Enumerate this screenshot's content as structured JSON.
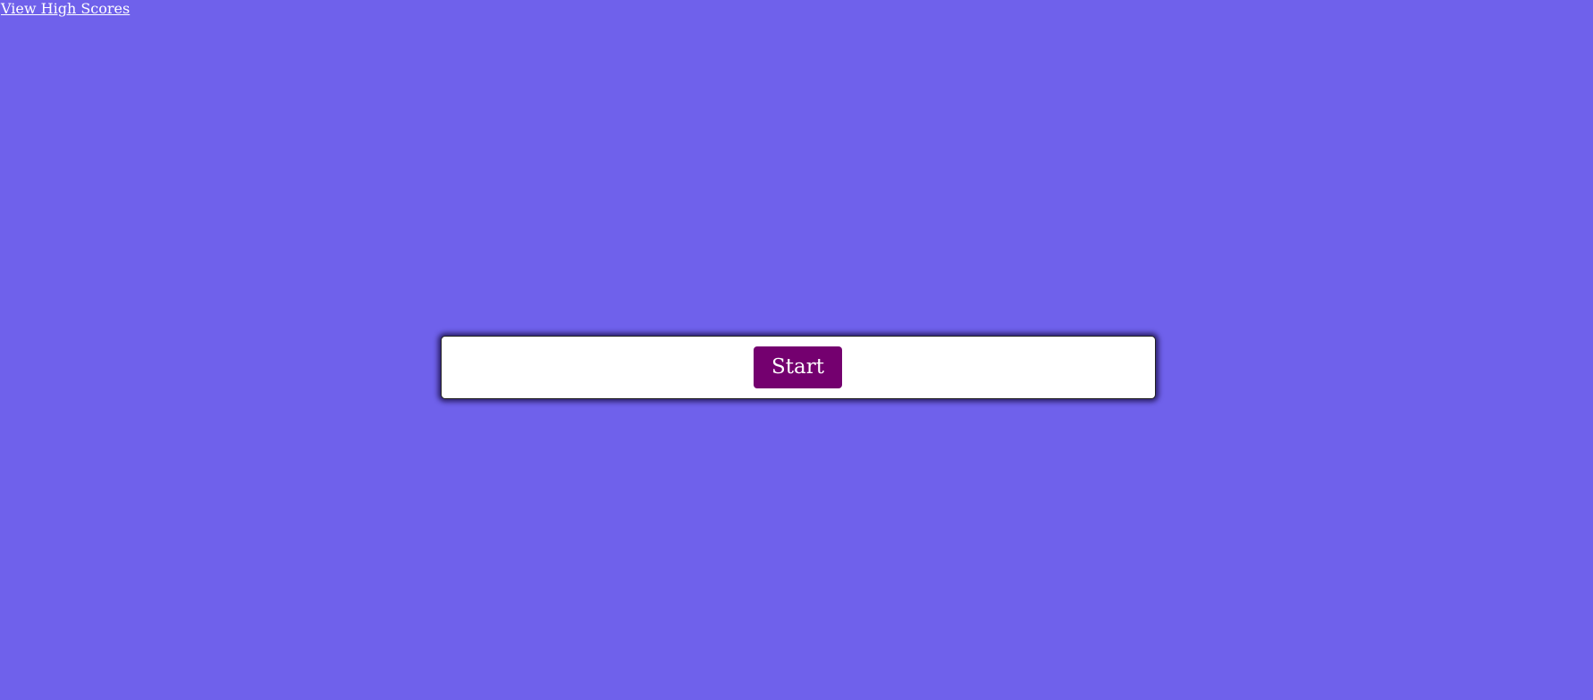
{
  "header": {
    "high_scores_link": "View High Scores"
  },
  "quiz": {
    "start_label": "Start"
  },
  "colors": {
    "background": "#6f61eb",
    "card": "#ffffff",
    "button": "#74006f",
    "text_on_dark": "#ffffff"
  }
}
